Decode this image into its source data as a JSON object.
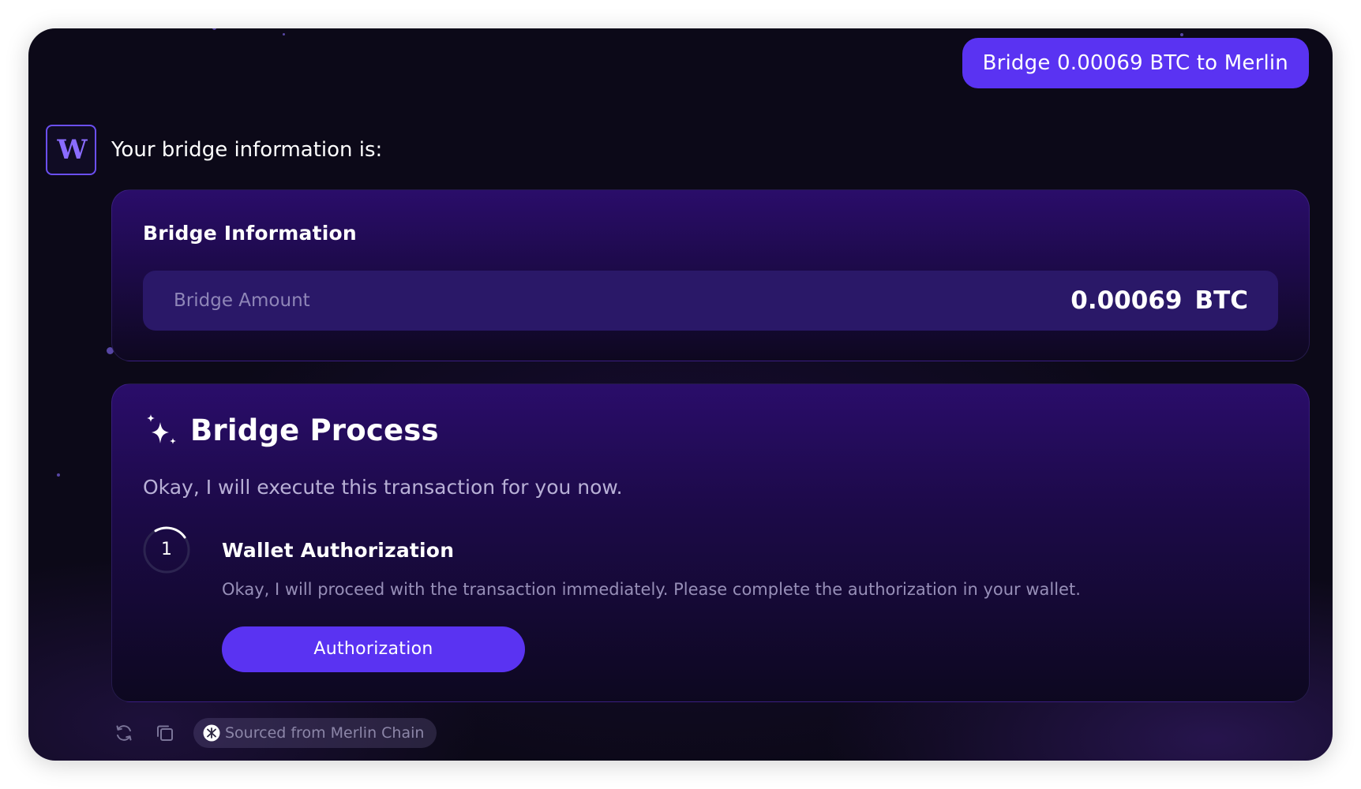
{
  "user_message": "Bridge 0.00069 BTC to Merlin",
  "assistant": {
    "avatar_letter": "W",
    "intro": "Your bridge information is:"
  },
  "bridge_info": {
    "title": "Bridge Information",
    "amount_label": "Bridge Amount",
    "amount_value": "0.00069",
    "amount_unit": "BTC"
  },
  "process": {
    "title": "Bridge Process",
    "description": "Okay, I will execute this transaction for you now.",
    "steps": [
      {
        "number": "1",
        "title": "Wallet Authorization",
        "description": "Okay, I will proceed with the transaction immediately. Please complete the authorization in your wallet.",
        "button_label": "Authorization"
      }
    ]
  },
  "footer": {
    "icons": [
      "refresh-icon",
      "copy-icon"
    ],
    "source_label": "Sourced from Merlin Chain",
    "source_icon": "merlin-chain-logo-icon"
  },
  "colors": {
    "accent": "#5a33f2",
    "background": "#0c0918",
    "card": "#2a0d6a",
    "amount_row": "#2a1868"
  }
}
